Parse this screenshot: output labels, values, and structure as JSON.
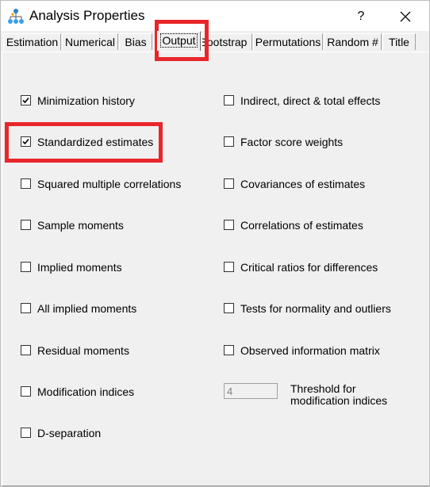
{
  "window": {
    "title": "Analysis Properties",
    "help_label": "?",
    "icon": "network-icon",
    "highlight_color": "#e8262a"
  },
  "tabs": [
    {
      "label": "Estimation",
      "active": false
    },
    {
      "label": "Numerical",
      "active": false
    },
    {
      "label": "Bias",
      "active": false
    },
    {
      "label": "Output",
      "active": true
    },
    {
      "label": "Bootstrap",
      "active": false
    },
    {
      "label": "Permutations",
      "active": false
    },
    {
      "label": "Random #",
      "active": false
    },
    {
      "label": "Title",
      "active": false
    }
  ],
  "left_options": [
    {
      "label": "Minimization history",
      "checked": true
    },
    {
      "label": "Standardized estimates",
      "checked": true
    },
    {
      "label": "Squared multiple correlations",
      "checked": false
    },
    {
      "label": "Sample moments",
      "checked": false
    },
    {
      "label": "Implied moments",
      "checked": false
    },
    {
      "label": "All implied moments",
      "checked": false
    },
    {
      "label": "Residual moments",
      "checked": false
    },
    {
      "label": "Modification indices",
      "checked": false
    },
    {
      "label": "D-separation",
      "checked": false
    }
  ],
  "right_options": [
    {
      "label": "Indirect, direct & total effects",
      "checked": false
    },
    {
      "label": "Factor score weights",
      "checked": false
    },
    {
      "label": "Covariances of estimates",
      "checked": false
    },
    {
      "label": "Correlations of estimates",
      "checked": false
    },
    {
      "label": "Critical ratios for differences",
      "checked": false
    },
    {
      "label": "Tests for normality and outliers",
      "checked": false
    },
    {
      "label": "Observed information matrix",
      "checked": false
    }
  ],
  "threshold": {
    "value": "4",
    "label_line1": "Threshold for",
    "label_line2": "modification indices"
  }
}
